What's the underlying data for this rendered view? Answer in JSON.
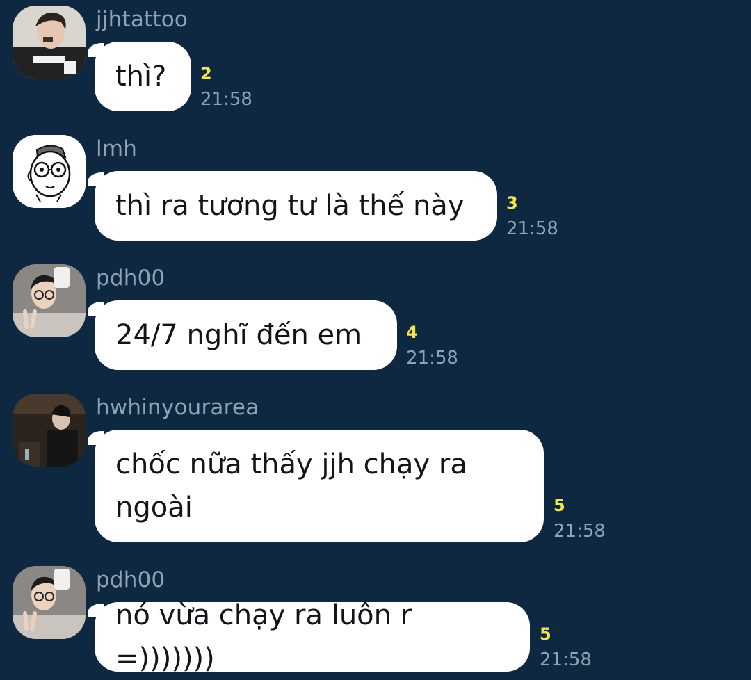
{
  "messages": [
    {
      "sender": "jjhtattoo",
      "text": "thì?",
      "unread": "2",
      "time": "21:58",
      "avatar_icon": "man-on-phone-photo"
    },
    {
      "sender": "lmh",
      "text": "thì ra tương tư là thế này",
      "unread": "3",
      "time": "21:58",
      "avatar_icon": "cartoon-glasses-face"
    },
    {
      "sender": "pdh00",
      "text": "24/7 nghĩ đến em",
      "unread": "4",
      "time": "21:58",
      "avatar_icon": "selfie-peace-sign-photo"
    },
    {
      "sender": "hwhinyourarea",
      "text": "chốc nữa thấy jjh chạy ra ngoài",
      "text_line1": "chốc nữa thấy jjh chạy ra",
      "text_line2": "ngoài",
      "unread": "5",
      "time": "21:58",
      "avatar_icon": "dark-cafe-photo"
    },
    {
      "sender": "pdh00",
      "text": "nó vừa chạy ra luôn r =)))))))",
      "unread": "5",
      "time": "21:58",
      "avatar_icon": "selfie-peace-sign-photo"
    }
  ],
  "colors": {
    "background": "#0d2840",
    "bubble": "#ffffff",
    "unread": "#f6e44a",
    "meta_text": "#8fa3b5"
  }
}
